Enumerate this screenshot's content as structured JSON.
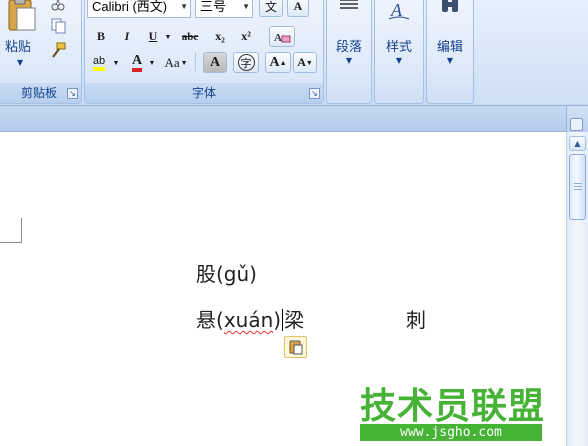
{
  "ribbon": {
    "clipboard": {
      "paste_label": "粘贴",
      "group_label": "剪贴板",
      "launcher_icon": "dialog-launcher-icon"
    },
    "font": {
      "font_name": "Calibri (西文)",
      "font_size": "三号",
      "group_label": "字体",
      "bold": "B",
      "italic": "I",
      "underline": "U",
      "strikethrough": "abc",
      "subscript": "x₂",
      "superscript": "x²",
      "change_case": "Aa",
      "grow": "A",
      "shrink": "A",
      "char_shading": "A",
      "enclose": "字",
      "phonetic": "文",
      "char_border": "A",
      "clear_format": "A",
      "highlight": "ab",
      "font_color": "A",
      "highlight_color": "#ffff00",
      "font_color_value": "#e02020"
    },
    "paragraph": {
      "label": "段落"
    },
    "styles": {
      "label": "样式"
    },
    "editing": {
      "label": "编辑"
    }
  },
  "document": {
    "line1": "股(gǔ)",
    "line2_prefix": "悬(",
    "line2_pinyin": "xuán",
    "line2_suffix": ")",
    "line2_after_caret": "梁",
    "word_ci": "刺",
    "paste_options_icon": "clipboard-paste-icon"
  },
  "watermark": {
    "title": "技术员联盟",
    "url": "www.jsgho.com",
    "color": "#46b336"
  }
}
